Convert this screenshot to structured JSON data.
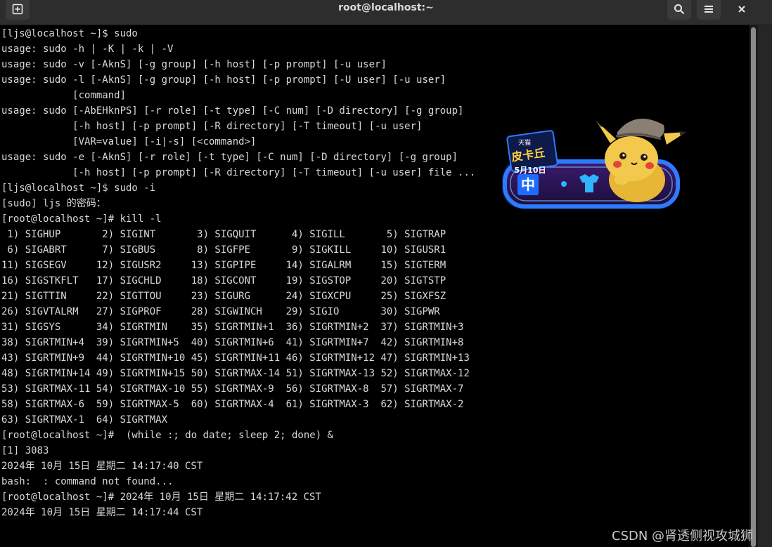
{
  "window": {
    "title": "root@localhost:~",
    "new_tab_icon": "new-tab-icon",
    "search_icon": "search-icon",
    "menu_icon": "hamburger-menu-icon",
    "close_icon": "close-icon"
  },
  "terminal": {
    "lines": [
      "[ljs@localhost ~]$ sudo",
      "usage: sudo -h | -K | -k | -V",
      "usage: sudo -v [-AknS] [-g group] [-h host] [-p prompt] [-u user]",
      "usage: sudo -l [-AknS] [-g group] [-h host] [-p prompt] [-U user] [-u user]",
      "            [command]",
      "usage: sudo [-AbEHknPS] [-r role] [-t type] [-C num] [-D directory] [-g group]",
      "            [-h host] [-p prompt] [-R directory] [-T timeout] [-u user]",
      "            [VAR=value] [-i|-s] [<command>]",
      "usage: sudo -e [-AknS] [-r role] [-t type] [-C num] [-D directory] [-g group]",
      "            [-h host] [-p prompt] [-R directory] [-T timeout] [-u user] file ...",
      "[ljs@localhost ~]$ sudo -i",
      "[sudo] ljs 的密码：",
      "[root@localhost ~]# kill -l",
      " 1) SIGHUP       2) SIGINT       3) SIGQUIT      4) SIGILL       5) SIGTRAP",
      " 6) SIGABRT      7) SIGBUS       8) SIGFPE       9) SIGKILL     10) SIGUSR1",
      "11) SIGSEGV     12) SIGUSR2     13) SIGPIPE     14) SIGALRM     15) SIGTERM",
      "16) SIGSTKFLT   17) SIGCHLD     18) SIGCONT     19) SIGSTOP     20) SIGTSTP",
      "21) SIGTTIN     22) SIGTTOU     23) SIGURG      24) SIGXCPU     25) SIGXFSZ",
      "26) SIGVTALRM   27) SIGPROF     28) SIGWINCH    29) SIGIO       30) SIGPWR",
      "31) SIGSYS      34) SIGRTMIN    35) SIGRTMIN+1  36) SIGRTMIN+2  37) SIGRTMIN+3",
      "38) SIGRTMIN+4  39) SIGRTMIN+5  40) SIGRTMIN+6  41) SIGRTMIN+7  42) SIGRTMIN+8",
      "43) SIGRTMIN+9  44) SIGRTMIN+10 45) SIGRTMIN+11 46) SIGRTMIN+12 47) SIGRTMIN+13",
      "48) SIGRTMIN+14 49) SIGRTMIN+15 50) SIGRTMAX-14 51) SIGRTMAX-13 52) SIGRTMAX-12",
      "53) SIGRTMAX-11 54) SIGRTMAX-10 55) SIGRTMAX-9  56) SIGRTMAX-8  57) SIGRTMAX-7",
      "58) SIGRTMAX-6  59) SIGRTMAX-5  60) SIGRTMAX-4  61) SIGRTMAX-3  62) SIGRTMAX-2",
      "63) SIGRTMAX-1  64) SIGRTMAX",
      "[root@localhost ~]#  (while :; do date; sleep 2; done) &",
      "[1] 3083",
      "2024年 10月 15日 星期二 14:17:40 CST",
      "bash:  : command not found...",
      "[root@localhost ~]# 2024年 10月 15日 星期二 14:17:42 CST",
      "2024年 10月 15日 星期二 14:17:44 CST"
    ]
  },
  "sticker": {
    "brand": "天猫",
    "title": "皮卡丘",
    "date": "5月10日",
    "badge": "中"
  },
  "watermark": "CSDN @肾透侧视攻城狮",
  "colors": {
    "terminal_bg": "#000000",
    "terminal_fg": "#d9d9d9",
    "titlebar_bg": "#2d2d2d",
    "sticker_blue": "#1e6cff",
    "sticker_yellow": "#f2c94c"
  }
}
